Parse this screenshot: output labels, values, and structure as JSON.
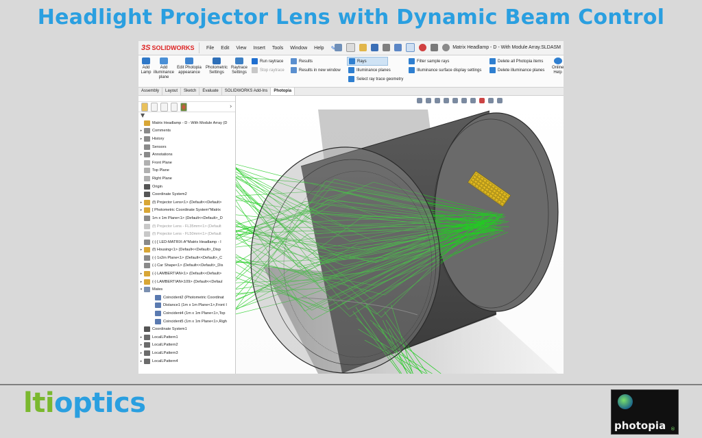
{
  "slide": {
    "title": "Headlight Projector Lens with Dynamic Beam Control",
    "brand_prefix": "lti",
    "brand_suffix": "optics",
    "logo_text": "photopia",
    "logo_mark": "®"
  },
  "app": {
    "logo": "SOLIDWORKS",
    "logo_prefix": "3S",
    "menu": [
      "File",
      "Edit",
      "View",
      "Insert",
      "Tools",
      "Window",
      "Help"
    ],
    "window_title": "Matrix Headlamp - D - With Module Array.SLDASM"
  },
  "ribbon": {
    "tools": [
      {
        "label": "Add Lamp",
        "icon": "lamp-icon"
      },
      {
        "label": "Add illuminance plane",
        "icon": "illuminance-plane-icon"
      },
      {
        "label": "Edit Photopia appearance",
        "icon": "appearance-icon"
      },
      {
        "label": "Photometric Settings",
        "icon": "photometric-icon"
      },
      {
        "label": "Raytrace Settings",
        "icon": "raytrace-settings-icon"
      }
    ],
    "run_raytrace": "Run raytrace",
    "stop_raytrace": "Stop raytrace",
    "results": "Results",
    "results_new_window": "Results in new window",
    "rays": "Rays",
    "illuminance_planes": "Illuminance planes",
    "select_ray_trace_geometry": "Select ray trace geometry",
    "filter_sample_rays": "Filter sample rays",
    "illuminance_surface_display": "Illuminance surface display settings",
    "delete_all_items": "Delete all Photopia items",
    "delete_illuminance_planes": "Delete illuminance planes",
    "online_help": "Online Help"
  },
  "tabs": [
    "Assembly",
    "Layout",
    "Sketch",
    "Evaluate",
    "SOLIDWORKS Add-Ins",
    "Photopia"
  ],
  "active_tab": "Photopia",
  "tree": [
    {
      "label": "Matrix Headlamp - D - With Module Array  (D",
      "arrow": "",
      "color": "#d8a636",
      "dim": false
    },
    {
      "label": "Comments",
      "arrow": "▸",
      "color": "#8a8a8a",
      "dim": false
    },
    {
      "label": "History",
      "arrow": "▸",
      "color": "#8a8a8a",
      "dim": false
    },
    {
      "label": "Sensors",
      "arrow": "",
      "color": "#8a8a8a",
      "dim": false
    },
    {
      "label": "Annotations",
      "arrow": "▸",
      "color": "#8a8a8a",
      "dim": false
    },
    {
      "label": "Front Plane",
      "arrow": "",
      "color": "#b0b0b0",
      "dim": false
    },
    {
      "label": "Top Plane",
      "arrow": "",
      "color": "#b0b0b0",
      "dim": false
    },
    {
      "label": "Right Plane",
      "arrow": "",
      "color": "#b0b0b0",
      "dim": false
    },
    {
      "label": "Origin",
      "arrow": "",
      "color": "#555555",
      "dim": false
    },
    {
      "label": "Coordinate System2",
      "arrow": "",
      "color": "#555555",
      "dim": false
    },
    {
      "label": "(f) Projector Lens<1> (Default<<Default>",
      "arrow": "▸",
      "color": "#d8a636",
      "dim": false
    },
    {
      "label": "[ Photometric Coordinate System^Matrix",
      "arrow": "▸",
      "color": "#d8a636",
      "dim": false
    },
    {
      "label": "1m x 1m Plane<1> (Default<<Default>_D",
      "arrow": "",
      "color": "#8a8a8a",
      "dim": false
    },
    {
      "label": "(f) Projector Lens - FL35mm<1> (Default",
      "arrow": "",
      "color": "#c8c8c8",
      "dim": true
    },
    {
      "label": "(f) Projector Lens - FL50mm<1> (Default",
      "arrow": "",
      "color": "#c8c8c8",
      "dim": true
    },
    {
      "label": "(-) [ LED-MATRIX-A^Matrix Headlamp - I",
      "arrow": "",
      "color": "#8a8a8a",
      "dim": false
    },
    {
      "label": "(f) Housing<1> (Default<<Default>_Disp",
      "arrow": "▸",
      "color": "#d8a636",
      "dim": false
    },
    {
      "label": "(-) 1x2m Plane<1> (Default<<Default>_C",
      "arrow": "",
      "color": "#8a8a8a",
      "dim": false
    },
    {
      "label": "(-) Car Shape<1> (Default<<Default>_Dis",
      "arrow": "",
      "color": "#8a8a8a",
      "dim": false
    },
    {
      "label": "(-) LAMBERTIAN<1> (Default<<Default>",
      "arrow": "▸",
      "color": "#d8a636",
      "dim": false
    },
    {
      "label": "(-) LAMBERTIAN<109> (Default<<Defaul",
      "arrow": "▸",
      "color": "#d8a636",
      "dim": false
    },
    {
      "label": "Mates",
      "arrow": "▾",
      "color": "#7a8fb0",
      "dim": false
    },
    {
      "label": "Coincident2 (Photometric Coordinat",
      "arrow": "",
      "color": "#5a7ab0",
      "dim": false,
      "indent": 2
    },
    {
      "label": "Distance1 (1m x 1m Plane<1>,Front I",
      "arrow": "",
      "color": "#5a7ab0",
      "dim": false,
      "indent": 2
    },
    {
      "label": "Coincident4 (1m x 1m Plane<1>,Top",
      "arrow": "",
      "color": "#5a7ab0",
      "dim": false,
      "indent": 2
    },
    {
      "label": "Coincident5 (1m x 1m Plane<1>,Righ",
      "arrow": "",
      "color": "#5a7ab0",
      "dim": false,
      "indent": 2
    },
    {
      "label": "Coordinate System1",
      "arrow": "",
      "color": "#555555",
      "dim": false
    },
    {
      "label": "LocalLPattern1",
      "arrow": "▸",
      "color": "#6b6b6b",
      "dim": false
    },
    {
      "label": "LocalLPattern2",
      "arrow": "▸",
      "color": "#6b6b6b",
      "dim": false
    },
    {
      "label": "LocalLPattern3",
      "arrow": "▸",
      "color": "#6b6b6b",
      "dim": false
    },
    {
      "label": "LocalLPattern4",
      "arrow": "▸",
      "color": "#6b6b6b",
      "dim": false
    }
  ],
  "colors": {
    "title": "#2a9fe0",
    "brand_green": "#7ab82e",
    "brand_blue": "#2a9fe0",
    "rays": "#22cc22",
    "led_array": "#e0b820"
  }
}
